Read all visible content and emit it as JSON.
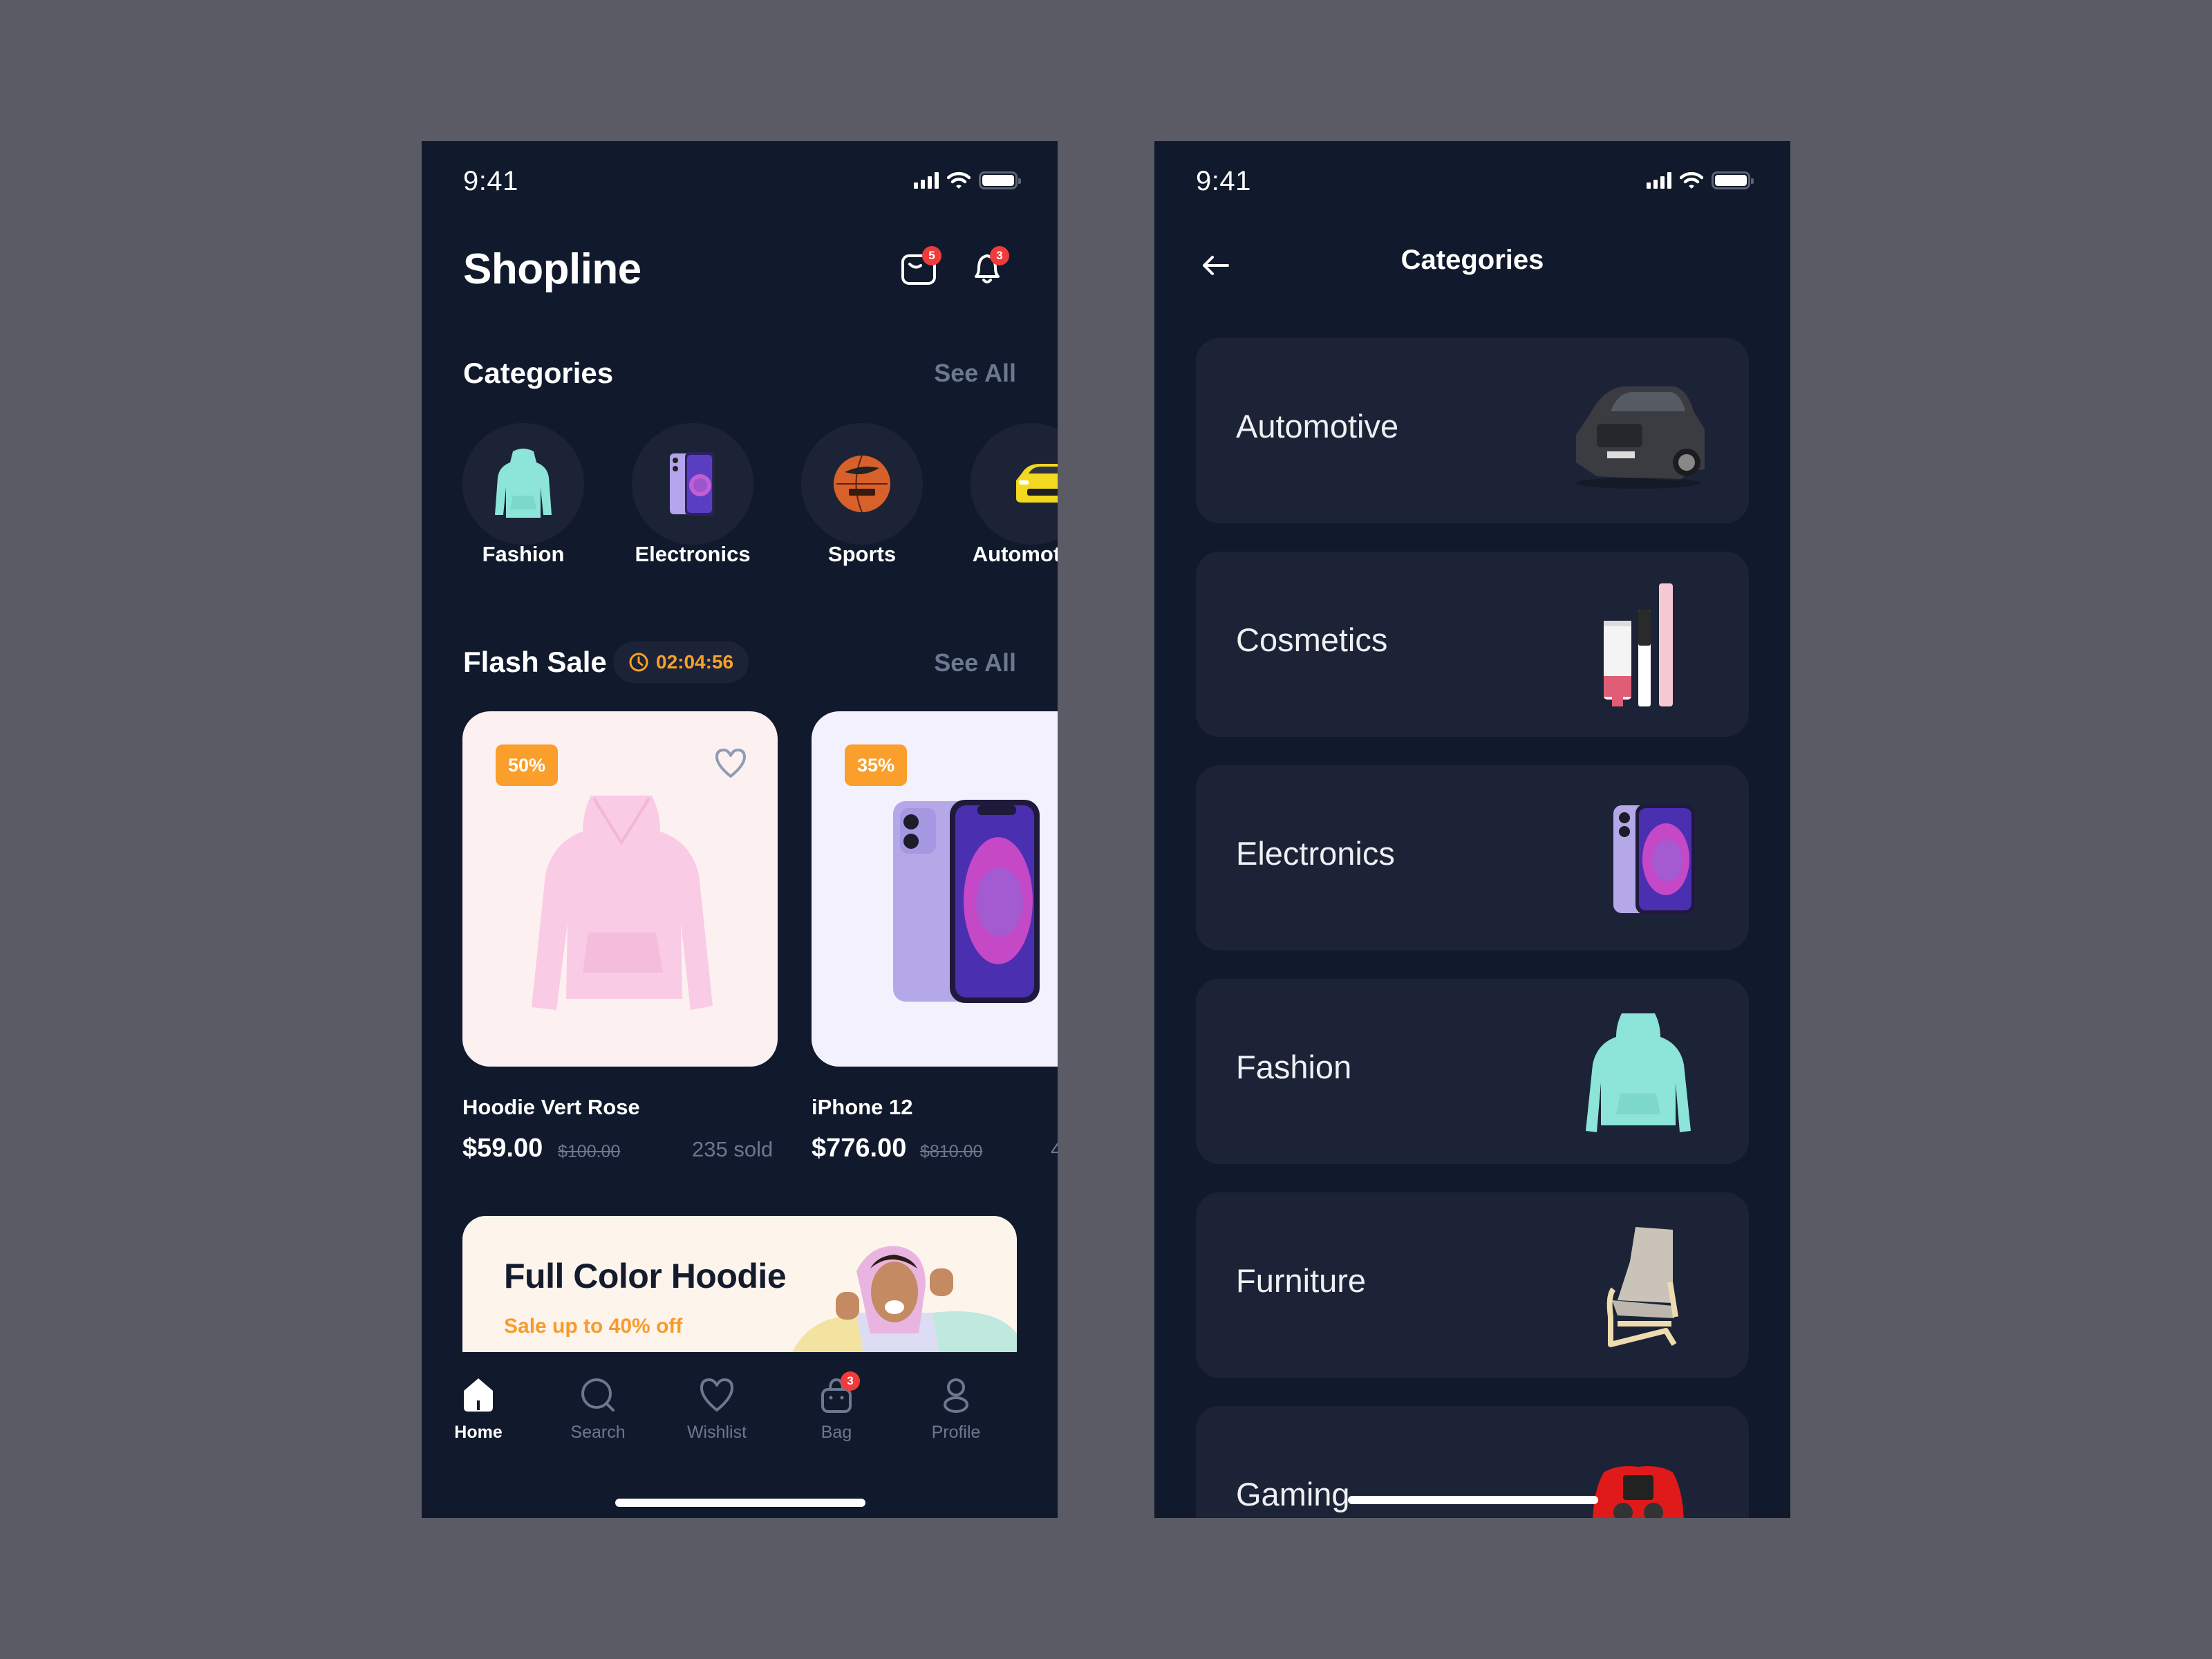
{
  "status_bar": {
    "time": "9:41"
  },
  "home": {
    "app_title": "Shopline",
    "header_icons": [
      {
        "name": "message-icon",
        "badge": "5"
      },
      {
        "name": "bell-icon",
        "badge": "3"
      }
    ],
    "categories": {
      "title": "Categories",
      "see_all": "See All",
      "items": [
        {
          "label": "Fashion",
          "icon": "hoodie-icon"
        },
        {
          "label": "Electronics",
          "icon": "phone-icon"
        },
        {
          "label": "Sports",
          "icon": "basketball-icon"
        },
        {
          "label": "Automotive",
          "icon": "car-icon"
        }
      ]
    },
    "flash_sale": {
      "title": "Flash Sale",
      "timer": "02:04:56",
      "see_all": "See All",
      "products": [
        {
          "name": "Hoodie Vert Rose",
          "price": "$59.00",
          "old_price": "$100.00",
          "sold": "235 sold",
          "discount": "50%",
          "bg": "#fdf0f1"
        },
        {
          "name": "iPhone 12",
          "price": "$776.00",
          "old_price": "$810.00",
          "sold": "4",
          "discount": "35%",
          "bg": "#f3f1fd"
        }
      ]
    },
    "banner": {
      "title": "Full Color Hoodie",
      "subtitle": "Sale up to 40% off"
    },
    "nav": {
      "items": [
        {
          "label": "Home",
          "icon": "home-icon",
          "active": true
        },
        {
          "label": "Search",
          "icon": "search-icon"
        },
        {
          "label": "Wishlist",
          "icon": "heart-icon"
        },
        {
          "label": "Bag",
          "icon": "bag-icon",
          "badge": "3"
        },
        {
          "label": "Profile",
          "icon": "profile-icon"
        }
      ]
    }
  },
  "categories_page": {
    "title": "Categories",
    "items": [
      {
        "label": "Automotive",
        "icon": "suv-icon"
      },
      {
        "label": "Cosmetics",
        "icon": "cosmetics-icon"
      },
      {
        "label": "Electronics",
        "icon": "phone-icon"
      },
      {
        "label": "Fashion",
        "icon": "hoodie-icon"
      },
      {
        "label": "Furniture",
        "icon": "chair-icon"
      },
      {
        "label": "Gaming",
        "icon": "gamepad-icon"
      }
    ]
  },
  "colors": {
    "background": "#5b5b66",
    "phone_bg": "#111a2c",
    "card_bg": "#1c2336",
    "accent_orange": "#fa9e2c",
    "badge_red": "#ef3b3b",
    "muted_text": "#6c7890"
  }
}
